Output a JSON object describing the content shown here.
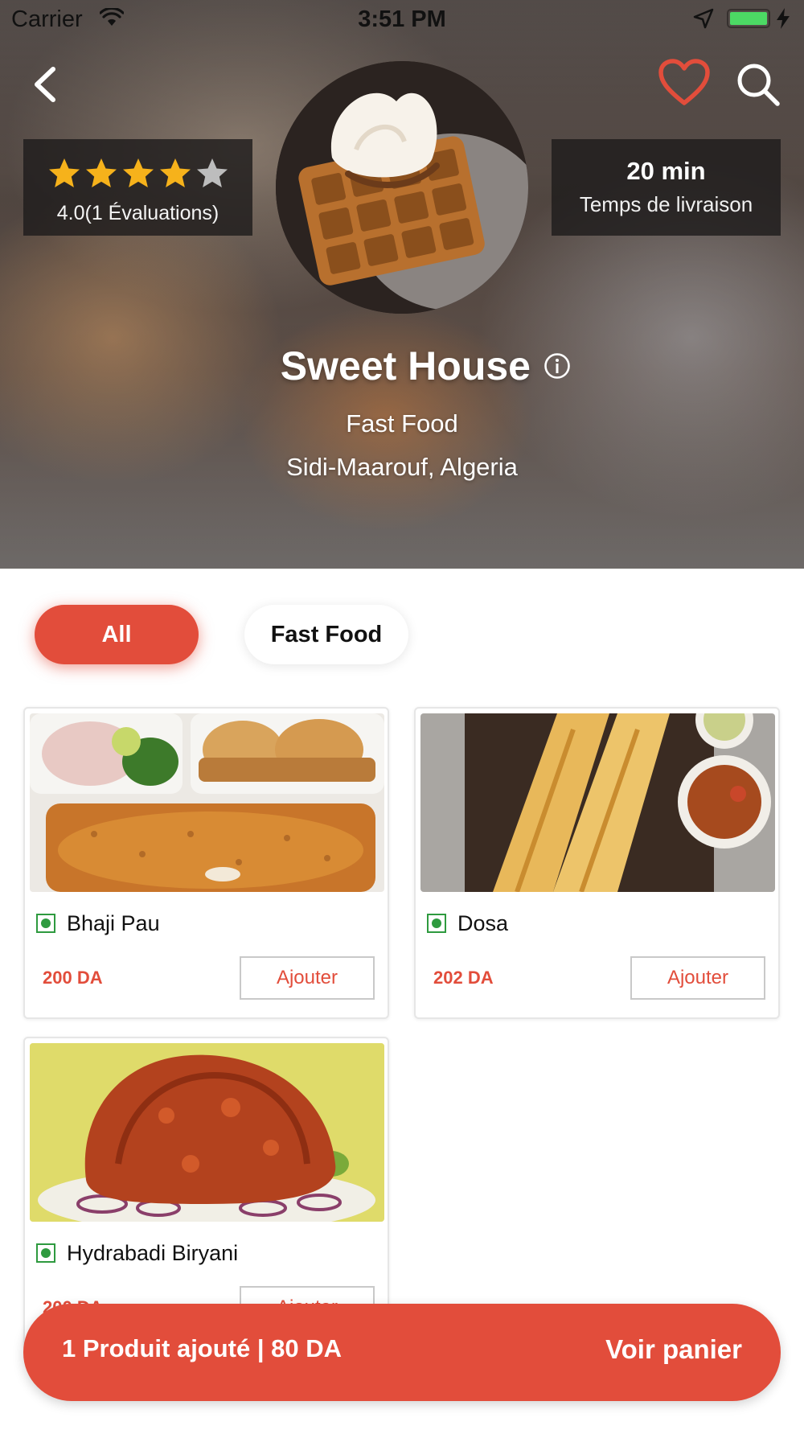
{
  "status_bar": {
    "carrier": "Carrier",
    "time": "3:51 PM"
  },
  "header": {
    "rating_value": 4,
    "rating_max": 5,
    "rating_text": "4.0(1 Évaluations)",
    "delivery_time": "20 min",
    "delivery_label": "Temps de livraison"
  },
  "restaurant": {
    "name": "Sweet House",
    "cuisine": "Fast Food",
    "location": "Sidi-Maarouf, Algeria"
  },
  "filters": [
    "All",
    "Fast Food"
  ],
  "products": [
    {
      "name": "Bhaji Pau",
      "price": "200 DA",
      "add_label": "Ajouter"
    },
    {
      "name": "Dosa",
      "price": "202 DA",
      "add_label": "Ajouter"
    },
    {
      "name": "Hydrabadi Biryani",
      "price": "200 DA",
      "add_label": "Ajouter"
    }
  ],
  "cart": {
    "summary": "1 Produit ajouté | 80 DA",
    "cta": "Voir panier"
  },
  "colors": {
    "accent": "#e24d3b",
    "veg": "#2e9a3f",
    "star": "#f6b21b",
    "battery": "#4cd964"
  },
  "icons": [
    "wifi-icon",
    "location-arrow-icon",
    "battery-icon",
    "back-chevron-icon",
    "heart-icon",
    "search-icon",
    "star-icon",
    "info-icon",
    "veg-icon"
  ]
}
